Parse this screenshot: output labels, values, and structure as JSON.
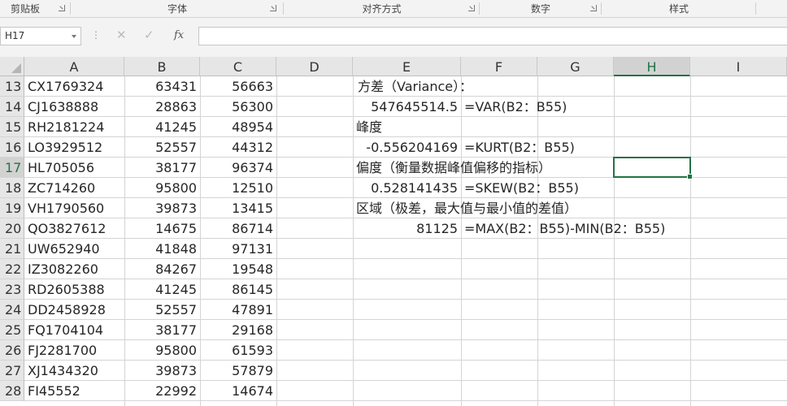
{
  "ribbon": {
    "groups": [
      "剪贴板",
      "字体",
      "对齐方式",
      "数字",
      "样式"
    ]
  },
  "formula_bar": {
    "name_box": "H17",
    "fx": "fx",
    "formula": ""
  },
  "columns": [
    "A",
    "B",
    "C",
    "D",
    "E",
    "F",
    "G",
    "H",
    "I"
  ],
  "selected_column": "H",
  "selected_row": "17",
  "rows": [
    {
      "num": "13",
      "a": "CX1769324",
      "b": "63431",
      "c": "56663"
    },
    {
      "num": "14",
      "a": "CJ1638888",
      "b": "28863",
      "c": "56300"
    },
    {
      "num": "15",
      "a": "RH2181224",
      "b": "41245",
      "c": "48954"
    },
    {
      "num": "16",
      "a": "LO3929512",
      "b": "52557",
      "c": "44312"
    },
    {
      "num": "17",
      "a": "HL705056",
      "b": "38177",
      "c": "96374"
    },
    {
      "num": "18",
      "a": "ZC714260",
      "b": "95800",
      "c": "12510"
    },
    {
      "num": "19",
      "a": "VH1790560",
      "b": "39873",
      "c": "13415"
    },
    {
      "num": "20",
      "a": "QO3827612",
      "b": "14675",
      "c": "86714"
    },
    {
      "num": "21",
      "a": "UW652940",
      "b": "41848",
      "c": "97131"
    },
    {
      "num": "22",
      "a": "IZ3082260",
      "b": "84267",
      "c": "19548"
    },
    {
      "num": "23",
      "a": "RD2605388",
      "b": "41245",
      "c": "86145"
    },
    {
      "num": "24",
      "a": "DD2458928",
      "b": "52557",
      "c": "47891"
    },
    {
      "num": "25",
      "a": "FQ1704104",
      "b": "38177",
      "c": "29168"
    },
    {
      "num": "26",
      "a": "FJ2281700",
      "b": "95800",
      "c": "61593"
    },
    {
      "num": "27",
      "a": "XJ1434320",
      "b": "39873",
      "c": "57879"
    },
    {
      "num": "28",
      "a": "FI45552",
      "b": "22992",
      "c": "14674"
    }
  ],
  "stats": {
    "variance_label": "方差（Variance）：",
    "variance_value": "547645514.5",
    "variance_formula": "=VAR(B2：B55)",
    "kurtosis_label": "峰度",
    "kurtosis_value": "-0.556204169",
    "kurtosis_formula": "=KURT(B2：B55)",
    "skew_label": "偏度（衡量数据峰值偏移的指标）",
    "skew_value": "0.528141435",
    "skew_formula": "=SKEW(B2：B55)",
    "range_label": "区域（极差，最大值与最小值的差值）",
    "range_value": "81125",
    "range_formula": "=MAX(B2：B55)-MIN(B2：B55)"
  },
  "colors": {
    "accent": "#217346",
    "header_bg": "#e6e6e6",
    "gridline": "#d4d4d4"
  }
}
